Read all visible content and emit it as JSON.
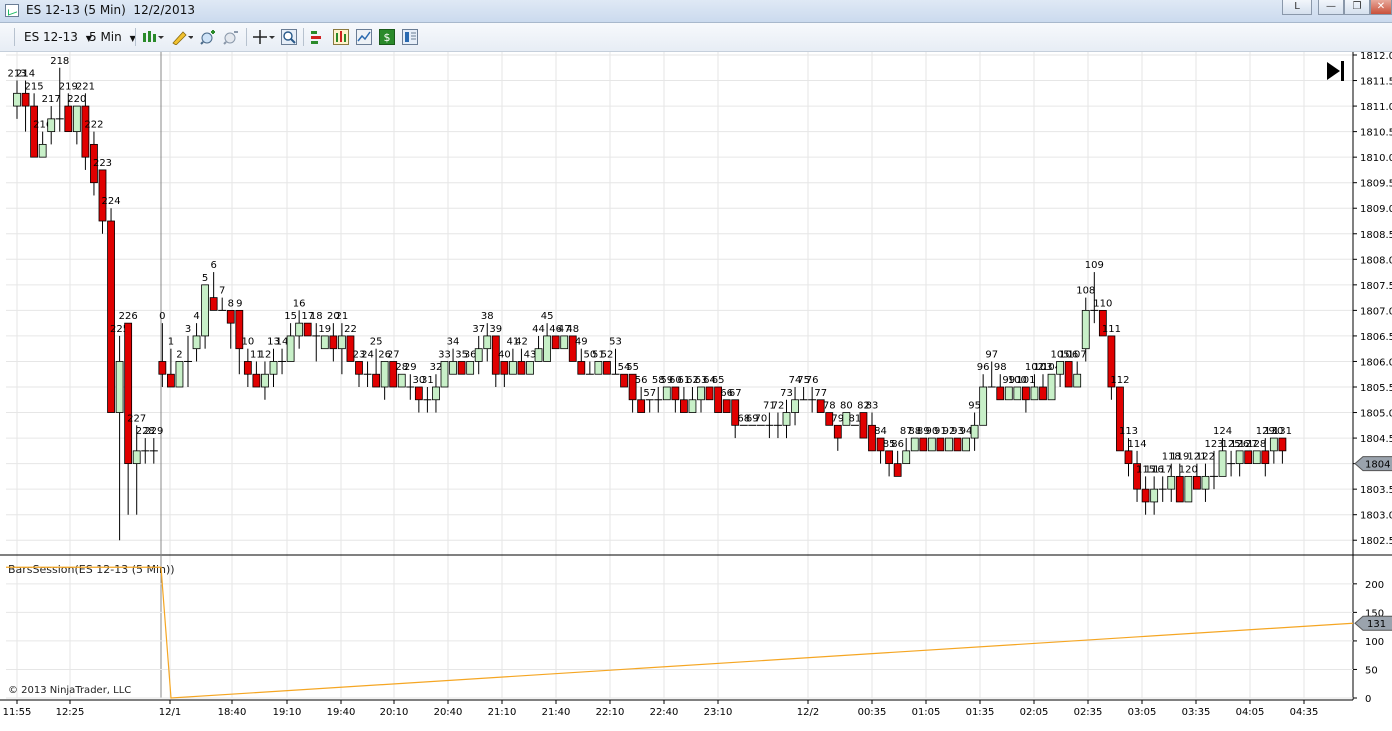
{
  "window": {
    "title": "ES 12-13 (5 Min)  12/2/2013",
    "buttons": {
      "layout_label": "L",
      "minimize_label": "—",
      "restore_label": "❐",
      "close_label": "✕"
    }
  },
  "toolbar": {
    "instrument": "ES 12-13",
    "interval": "5 Min",
    "icons": [
      "chart-style-icon",
      "drawing-pencil-icon",
      "zoom-in-icon",
      "zoom-out-icon",
      "crosshair-icon",
      "magnifier-icon",
      "data-series-icon",
      "indicators-icon",
      "strategies-icon",
      "dollar-icon",
      "properties-icon"
    ]
  },
  "colors": {
    "up_candle": "#c8f0c8",
    "down_candle": "#e00000",
    "wick": "#000000",
    "indicator_line": "#f5a623",
    "grid": "#e6e6e6"
  },
  "chart_data": {
    "type": "candlestick",
    "price_axis": {
      "ticks": [
        "1812.0",
        "1811.5",
        "1811.0",
        "1810.5",
        "1810.0",
        "1809.5",
        "1809.0",
        "1808.5",
        "1808.0",
        "1807.5",
        "1807.0",
        "1806.5",
        "1806.0",
        "1805.5",
        "1805.0",
        "1804.5",
        "1804.0",
        "1803.5",
        "1803.0",
        "1802.5"
      ],
      "ylim": [
        1802.25,
        1812.0
      ],
      "current_price_label": "1804"
    },
    "time_axis": {
      "ticks": [
        "11:55",
        "12:25",
        "12/1",
        "18:40",
        "19:10",
        "19:40",
        "20:10",
        "20:40",
        "21:10",
        "21:40",
        "22:10",
        "22:40",
        "23:10",
        "12/2",
        "00:35",
        "01:05",
        "01:35",
        "02:05",
        "02:35",
        "03:05",
        "03:35",
        "04:05",
        "04:35"
      ]
    },
    "session_break_label": "12/1",
    "bars": [
      [
        "213",
        1811.0,
        1811.5,
        1810.75,
        1811.25
      ],
      [
        "214",
        1811.25,
        1811.5,
        1810.5,
        1811.0
      ],
      [
        "215",
        1811.0,
        1811.25,
        1810.0,
        1810.0
      ],
      [
        "216",
        1810.0,
        1810.5,
        1810.0,
        1810.25
      ],
      [
        "217",
        1810.5,
        1811.0,
        1810.25,
        1810.75
      ],
      [
        "218",
        1810.75,
        1811.75,
        1810.5,
        1810.75
      ],
      [
        "219",
        1811.0,
        1811.25,
        1810.5,
        1810.5
      ],
      [
        "220",
        1810.5,
        1811.0,
        1810.25,
        1811.0
      ],
      [
        "221",
        1811.0,
        1811.25,
        1809.75,
        1810.0
      ],
      [
        "222",
        1810.25,
        1810.5,
        1809.25,
        1809.5
      ],
      [
        "223",
        1809.75,
        1809.75,
        1808.5,
        1808.75
      ],
      [
        "224",
        1808.75,
        1809.0,
        1805.0,
        1805.0
      ],
      [
        "225",
        1805.0,
        1806.5,
        1802.5,
        1806.0
      ],
      [
        "226",
        1806.75,
        1806.75,
        1803.0,
        1804.0
      ],
      [
        "227",
        1804.0,
        1804.75,
        1803.0,
        1804.25
      ],
      [
        "228",
        1804.25,
        1804.5,
        1804.0,
        1804.25
      ],
      [
        "229",
        1804.25,
        1804.5,
        1804.0,
        1804.25
      ],
      [
        "0",
        1806.0,
        1806.75,
        1805.5,
        1805.75
      ],
      [
        "1",
        1805.75,
        1806.25,
        1805.5,
        1805.5
      ],
      [
        "2",
        1805.5,
        1806.0,
        1805.5,
        1806.0
      ],
      [
        "3",
        1806.0,
        1806.5,
        1805.5,
        1806.0
      ],
      [
        "4",
        1806.25,
        1806.75,
        1806.0,
        1806.5
      ],
      [
        "5",
        1806.5,
        1807.5,
        1806.25,
        1807.5
      ],
      [
        "6",
        1807.25,
        1807.75,
        1807.0,
        1807.0
      ],
      [
        "7",
        1807.0,
        1807.25,
        1807.0,
        1807.0
      ],
      [
        "8",
        1807.0,
        1807.0,
        1806.25,
        1806.75
      ],
      [
        "9",
        1807.0,
        1807.0,
        1805.75,
        1806.25
      ],
      [
        "10",
        1806.0,
        1806.25,
        1805.5,
        1805.75
      ],
      [
        "11",
        1805.75,
        1806.0,
        1805.5,
        1805.5
      ],
      [
        "12",
        1805.5,
        1806.0,
        1805.25,
        1805.75
      ],
      [
        "13",
        1805.75,
        1806.25,
        1805.5,
        1806.0
      ],
      [
        "14",
        1806.0,
        1806.25,
        1805.75,
        1806.0
      ],
      [
        "15",
        1806.0,
        1806.75,
        1806.0,
        1806.5
      ],
      [
        "16",
        1806.5,
        1807.0,
        1806.25,
        1806.75
      ],
      [
        "17",
        1806.75,
        1806.75,
        1806.5,
        1806.5
      ],
      [
        "18",
        1806.5,
        1806.75,
        1806.0,
        1806.5
      ],
      [
        "19",
        1806.25,
        1806.5,
        1806.25,
        1806.5
      ],
      [
        "20",
        1806.5,
        1806.75,
        1806.0,
        1806.25
      ],
      [
        "21",
        1806.25,
        1806.75,
        1805.75,
        1806.5
      ],
      [
        "22",
        1806.5,
        1806.5,
        1806.0,
        1806.0
      ],
      [
        "23",
        1806.0,
        1806.0,
        1805.5,
        1805.75
      ],
      [
        "24",
        1805.75,
        1806.0,
        1805.5,
        1805.75
      ],
      [
        "25",
        1805.75,
        1806.25,
        1805.5,
        1805.5
      ],
      [
        "26",
        1805.5,
        1806.0,
        1805.25,
        1806.0
      ],
      [
        "27",
        1806.0,
        1806.0,
        1805.5,
        1805.5
      ],
      [
        "28",
        1805.5,
        1805.75,
        1805.5,
        1805.75
      ],
      [
        "29",
        1805.5,
        1805.75,
        1805.25,
        1805.5
      ],
      [
        "30",
        1805.5,
        1805.5,
        1805.0,
        1805.25
      ],
      [
        "31",
        1805.25,
        1805.5,
        1805.0,
        1805.25
      ],
      [
        "32",
        1805.25,
        1805.75,
        1805.0,
        1805.5
      ],
      [
        "33",
        1805.5,
        1806.0,
        1805.5,
        1806.0
      ],
      [
        "34",
        1805.75,
        1806.25,
        1805.75,
        1806.0
      ],
      [
        "35",
        1806.0,
        1806.0,
        1805.75,
        1805.75
      ],
      [
        "36",
        1805.75,
        1806.0,
        1805.75,
        1806.0
      ],
      [
        "37",
        1806.0,
        1806.5,
        1805.75,
        1806.25
      ],
      [
        "38",
        1806.25,
        1806.75,
        1806.0,
        1806.5
      ],
      [
        "39",
        1806.5,
        1806.5,
        1805.5,
        1805.75
      ],
      [
        "40",
        1806.0,
        1806.0,
        1805.5,
        1805.75
      ],
      [
        "41",
        1805.75,
        1806.25,
        1805.75,
        1806.0
      ],
      [
        "42",
        1806.0,
        1806.25,
        1805.75,
        1805.75
      ],
      [
        "43",
        1805.75,
        1806.0,
        1805.75,
        1806.0
      ],
      [
        "44",
        1806.0,
        1806.5,
        1806.0,
        1806.25
      ],
      [
        "45",
        1806.0,
        1806.75,
        1806.0,
        1806.5
      ],
      [
        "46",
        1806.5,
        1806.5,
        1806.25,
        1806.25
      ],
      [
        "47",
        1806.25,
        1806.5,
        1806.25,
        1806.5
      ],
      [
        "48",
        1806.5,
        1806.5,
        1806.0,
        1806.0
      ],
      [
        "49",
        1806.0,
        1806.25,
        1805.75,
        1805.75
      ],
      [
        "50",
        1805.75,
        1806.0,
        1805.75,
        1805.75
      ],
      [
        "51",
        1805.75,
        1806.0,
        1805.75,
        1806.0
      ],
      [
        "52",
        1806.0,
        1806.0,
        1805.75,
        1805.75
      ],
      [
        "53",
        1805.75,
        1806.25,
        1805.75,
        1805.75
      ],
      [
        "54",
        1805.75,
        1805.75,
        1805.5,
        1805.5
      ],
      [
        "55",
        1805.75,
        1805.75,
        1805.0,
        1805.25
      ],
      [
        "56",
        1805.25,
        1805.5,
        1805.0,
        1805.0
      ],
      [
        "57",
        1805.25,
        1805.25,
        1805.0,
        1805.25
      ],
      [
        "58",
        1805.25,
        1805.5,
        1805.0,
        1805.25
      ],
      [
        "59",
        1805.25,
        1805.5,
        1805.25,
        1805.5
      ],
      [
        "60",
        1805.5,
        1805.5,
        1805.0,
        1805.25
      ],
      [
        "61",
        1805.25,
        1805.5,
        1805.0,
        1805.0
      ],
      [
        "62",
        1805.0,
        1805.5,
        1805.0,
        1805.25
      ],
      [
        "63",
        1805.25,
        1805.5,
        1805.0,
        1805.5
      ],
      [
        "64",
        1805.5,
        1805.5,
        1805.25,
        1805.25
      ],
      [
        "65",
        1805.5,
        1805.5,
        1805.0,
        1805.0
      ],
      [
        "66",
        1805.25,
        1805.25,
        1805.0,
        1805.0
      ],
      [
        "67",
        1805.25,
        1805.25,
        1804.5,
        1804.75
      ],
      [
        "68",
        1804.75,
        1804.75,
        1804.75,
        1804.75
      ],
      [
        "69",
        1804.75,
        1804.75,
        1804.75,
        1804.75
      ],
      [
        "70",
        1804.75,
        1804.75,
        1804.75,
        1804.75
      ],
      [
        "71",
        1804.75,
        1805.0,
        1804.5,
        1804.75
      ],
      [
        "72",
        1804.75,
        1805.0,
        1804.5,
        1804.75
      ],
      [
        "73",
        1804.75,
        1805.25,
        1804.5,
        1805.0
      ],
      [
        "74",
        1805.0,
        1805.5,
        1804.75,
        1805.25
      ],
      [
        "75",
        1805.25,
        1805.5,
        1805.25,
        1805.25
      ],
      [
        "76",
        1805.25,
        1805.5,
        1805.0,
        1805.25
      ],
      [
        "77",
        1805.25,
        1805.25,
        1805.0,
        1805.0
      ],
      [
        "78",
        1805.0,
        1805.0,
        1804.75,
        1804.75
      ],
      [
        "79",
        1804.75,
        1804.75,
        1804.25,
        1804.5
      ],
      [
        "80",
        1804.75,
        1805.0,
        1804.75,
        1805.0
      ],
      [
        "81",
        1804.75,
        1804.75,
        1804.75,
        1804.75
      ],
      [
        "82",
        1805.0,
        1805.0,
        1804.5,
        1804.5
      ],
      [
        "83",
        1804.75,
        1805.0,
        1804.25,
        1804.25
      ],
      [
        "84",
        1804.5,
        1804.5,
        1804.0,
        1804.25
      ],
      [
        "85",
        1804.25,
        1804.25,
        1803.75,
        1804.0
      ],
      [
        "86",
        1804.0,
        1804.25,
        1803.75,
        1803.75
      ],
      [
        "87",
        1804.0,
        1804.5,
        1804.0,
        1804.25
      ],
      [
        "88",
        1804.25,
        1804.5,
        1804.25,
        1804.5
      ],
      [
        "89",
        1804.5,
        1804.5,
        1804.25,
        1804.25
      ],
      [
        "90",
        1804.25,
        1804.5,
        1804.25,
        1804.5
      ],
      [
        "91",
        1804.5,
        1804.5,
        1804.25,
        1804.25
      ],
      [
        "92",
        1804.25,
        1804.5,
        1804.25,
        1804.5
      ],
      [
        "93",
        1804.5,
        1804.5,
        1804.25,
        1804.25
      ],
      [
        "94",
        1804.25,
        1804.5,
        1804.25,
        1804.5
      ],
      [
        "95",
        1804.5,
        1805.0,
        1804.25,
        1804.75
      ],
      [
        "96",
        1804.75,
        1805.75,
        1804.75,
        1805.5
      ],
      [
        "97",
        1805.5,
        1806.0,
        1805.5,
        1805.5
      ],
      [
        "98",
        1805.5,
        1805.75,
        1805.25,
        1805.25
      ],
      [
        "99",
        1805.25,
        1805.5,
        1805.25,
        1805.5
      ],
      [
        "100",
        1805.25,
        1805.5,
        1805.25,
        1805.5
      ],
      [
        "101",
        1805.5,
        1805.5,
        1805.0,
        1805.25
      ],
      [
        "102",
        1805.25,
        1805.75,
        1805.25,
        1805.5
      ],
      [
        "103",
        1805.5,
        1805.75,
        1805.25,
        1805.25
      ],
      [
        "104",
        1805.25,
        1805.75,
        1805.25,
        1805.75
      ],
      [
        "105",
        1805.75,
        1806.0,
        1805.5,
        1806.0
      ],
      [
        "106",
        1806.0,
        1806.0,
        1805.5,
        1805.5
      ],
      [
        "107",
        1805.5,
        1806.0,
        1805.5,
        1805.75
      ],
      [
        "108",
        1806.25,
        1807.25,
        1806.0,
        1807.0
      ],
      [
        "109",
        1807.0,
        1807.75,
        1806.75,
        1807.0
      ],
      [
        "110",
        1807.0,
        1807.0,
        1806.5,
        1806.5
      ],
      [
        "111",
        1806.5,
        1806.5,
        1805.25,
        1805.5
      ],
      [
        "112",
        1805.5,
        1805.5,
        1804.25,
        1804.25
      ],
      [
        "113",
        1804.25,
        1804.5,
        1803.75,
        1804.0
      ],
      [
        "114",
        1804.0,
        1804.25,
        1803.25,
        1803.5
      ],
      [
        "115",
        1803.5,
        1803.75,
        1803.0,
        1803.25
      ],
      [
        "116",
        1803.25,
        1803.75,
        1803.0,
        1803.5
      ],
      [
        "117",
        1803.5,
        1803.75,
        1803.25,
        1803.5
      ],
      [
        "118",
        1803.5,
        1804.0,
        1803.25,
        1803.75
      ],
      [
        "119",
        1803.75,
        1804.0,
        1803.25,
        1803.25
      ],
      [
        "120",
        1803.25,
        1803.75,
        1803.25,
        1803.75
      ],
      [
        "121",
        1803.75,
        1804.0,
        1803.5,
        1803.5
      ],
      [
        "122",
        1803.5,
        1804.0,
        1803.25,
        1803.75
      ],
      [
        "123",
        1803.75,
        1804.25,
        1803.5,
        1803.75
      ],
      [
        "124",
        1803.75,
        1804.5,
        1803.75,
        1804.25
      ],
      [
        "125",
        1804.0,
        1804.25,
        1803.75,
        1804.0
      ],
      [
        "126",
        1804.0,
        1804.25,
        1803.75,
        1804.25
      ],
      [
        "127",
        1804.25,
        1804.25,
        1804.0,
        1804.0
      ],
      [
        "128",
        1804.0,
        1804.25,
        1804.0,
        1804.25
      ],
      [
        "129",
        1804.25,
        1804.5,
        1803.75,
        1804.0
      ],
      [
        "130",
        1804.25,
        1804.5,
        1804.0,
        1804.5
      ],
      [
        "131",
        1804.5,
        1804.5,
        1804.0,
        1804.25
      ]
    ],
    "bar_labels": [
      "213",
      "214",
      "215",
      "216",
      "217",
      "218",
      "219",
      "220",
      "221",
      "222",
      "223",
      "224",
      "225",
      "226",
      "227",
      "228",
      "229",
      "0",
      "1",
      "2",
      "3",
      "4",
      "5",
      "6",
      "7",
      "8",
      "9",
      "10",
      "11",
      "12",
      "13",
      "14",
      "15",
      "16",
      "17",
      "18",
      "19",
      "20",
      "21",
      "22",
      "23",
      "24",
      "25",
      "26",
      "27",
      "28",
      "29",
      "30",
      "31",
      "32",
      "33",
      "34",
      "35",
      "36",
      "37",
      "38",
      "39",
      "40",
      "41",
      "42",
      "43",
      "44",
      "45",
      "46",
      "47",
      "48",
      "49",
      "50",
      "51",
      "52",
      "53",
      "54",
      "55",
      "56",
      "57",
      "58",
      "59",
      "60",
      "61",
      "62",
      "63",
      "64",
      "65",
      "66",
      "67",
      "68",
      "69",
      "70",
      "71",
      "72",
      "73",
      "74",
      "75",
      "76",
      "77",
      "78",
      "79",
      "80",
      "81",
      "82",
      "83",
      "84",
      "85",
      "86",
      "87",
      "88",
      "89",
      "90",
      "91",
      "92",
      "93",
      "94",
      "95",
      "96",
      "97",
      "98",
      "99",
      "100",
      "101",
      "102",
      "103",
      "104",
      "105",
      "106",
      "107",
      "108",
      "109",
      "110",
      "111",
      "112",
      "113",
      "114",
      "115",
      "116",
      "117",
      "118",
      "119",
      "120",
      "121",
      "122",
      "123",
      "124",
      "125",
      "126",
      "127",
      "128",
      "129",
      "130",
      "131"
    ],
    "indicator": {
      "name": "BarsSession(ES 12-13 (5 Min))",
      "axis_ticks": [
        "200",
        "150",
        "100",
        "50",
        "0"
      ],
      "ylim": [
        0,
        240
      ],
      "current_value_label": "131",
      "values_start": 229,
      "values_after_reset": [
        0,
        131
      ]
    },
    "copyright": "© 2013 NinjaTrader, LLC"
  }
}
